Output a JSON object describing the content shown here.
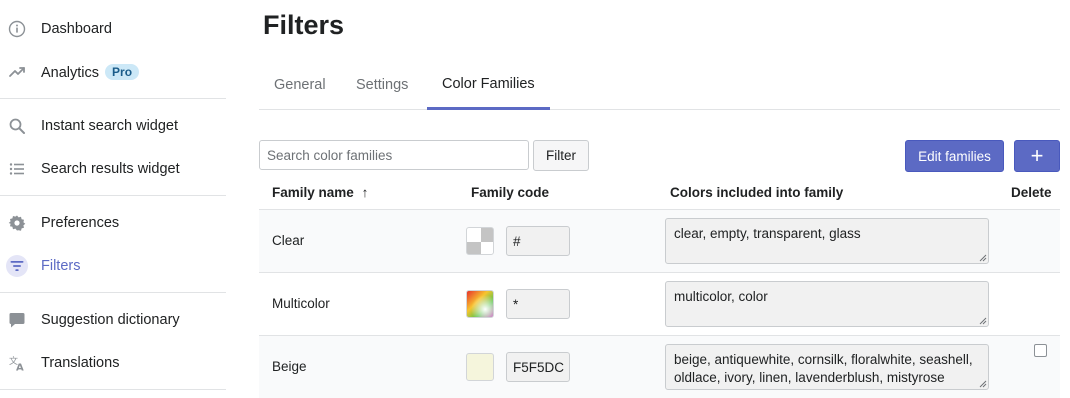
{
  "sidebar": {
    "items": [
      {
        "label": "Dashboard",
        "icon": "info-circle-icon"
      },
      {
        "label": "Analytics",
        "icon": "trending-up-icon",
        "badge": "Pro"
      },
      {
        "label": "Instant search widget",
        "icon": "search-icon"
      },
      {
        "label": "Search results widget",
        "icon": "list-icon"
      },
      {
        "label": "Preferences",
        "icon": "gear-icon"
      },
      {
        "label": "Filters",
        "icon": "filter-icon",
        "active": true
      },
      {
        "label": "Suggestion dictionary",
        "icon": "chat-bubble-icon"
      },
      {
        "label": "Translations",
        "icon": "translate-icon"
      }
    ]
  },
  "page": {
    "title": "Filters",
    "tabs": [
      {
        "label": "General"
      },
      {
        "label": "Settings"
      },
      {
        "label": "Color Families",
        "active": true
      }
    ]
  },
  "toolbar": {
    "search_placeholder": "Search color families",
    "search_value": "",
    "filter_label": "Filter",
    "edit_families_label": "Edit families",
    "add_label": "+"
  },
  "table": {
    "headers": {
      "family_name": "Family name",
      "family_name_sort": "↑",
      "family_code": "Family code",
      "colors": "Colors included into family",
      "delete": "Delete"
    },
    "rows": [
      {
        "name": "Clear",
        "code": "#",
        "swatch": "checkered",
        "colors": "clear, empty, transparent, glass",
        "deletable": false
      },
      {
        "name": "Multicolor",
        "code": "*",
        "swatch": "gradient",
        "colors": "multicolor, color",
        "deletable": false
      },
      {
        "name": "Beige",
        "code": "F5F5DC",
        "swatch": "#F5F5DC",
        "colors": "beige, antiquewhite, cornsilk, floralwhite, seashell, oldlace, ivory, linen, lavenderblush, mistyrose",
        "deletable": true
      }
    ]
  },
  "colors": {
    "accent": "#5c6ac4",
    "badge_bg": "#cce8f7",
    "badge_text": "#1a5c8a"
  }
}
